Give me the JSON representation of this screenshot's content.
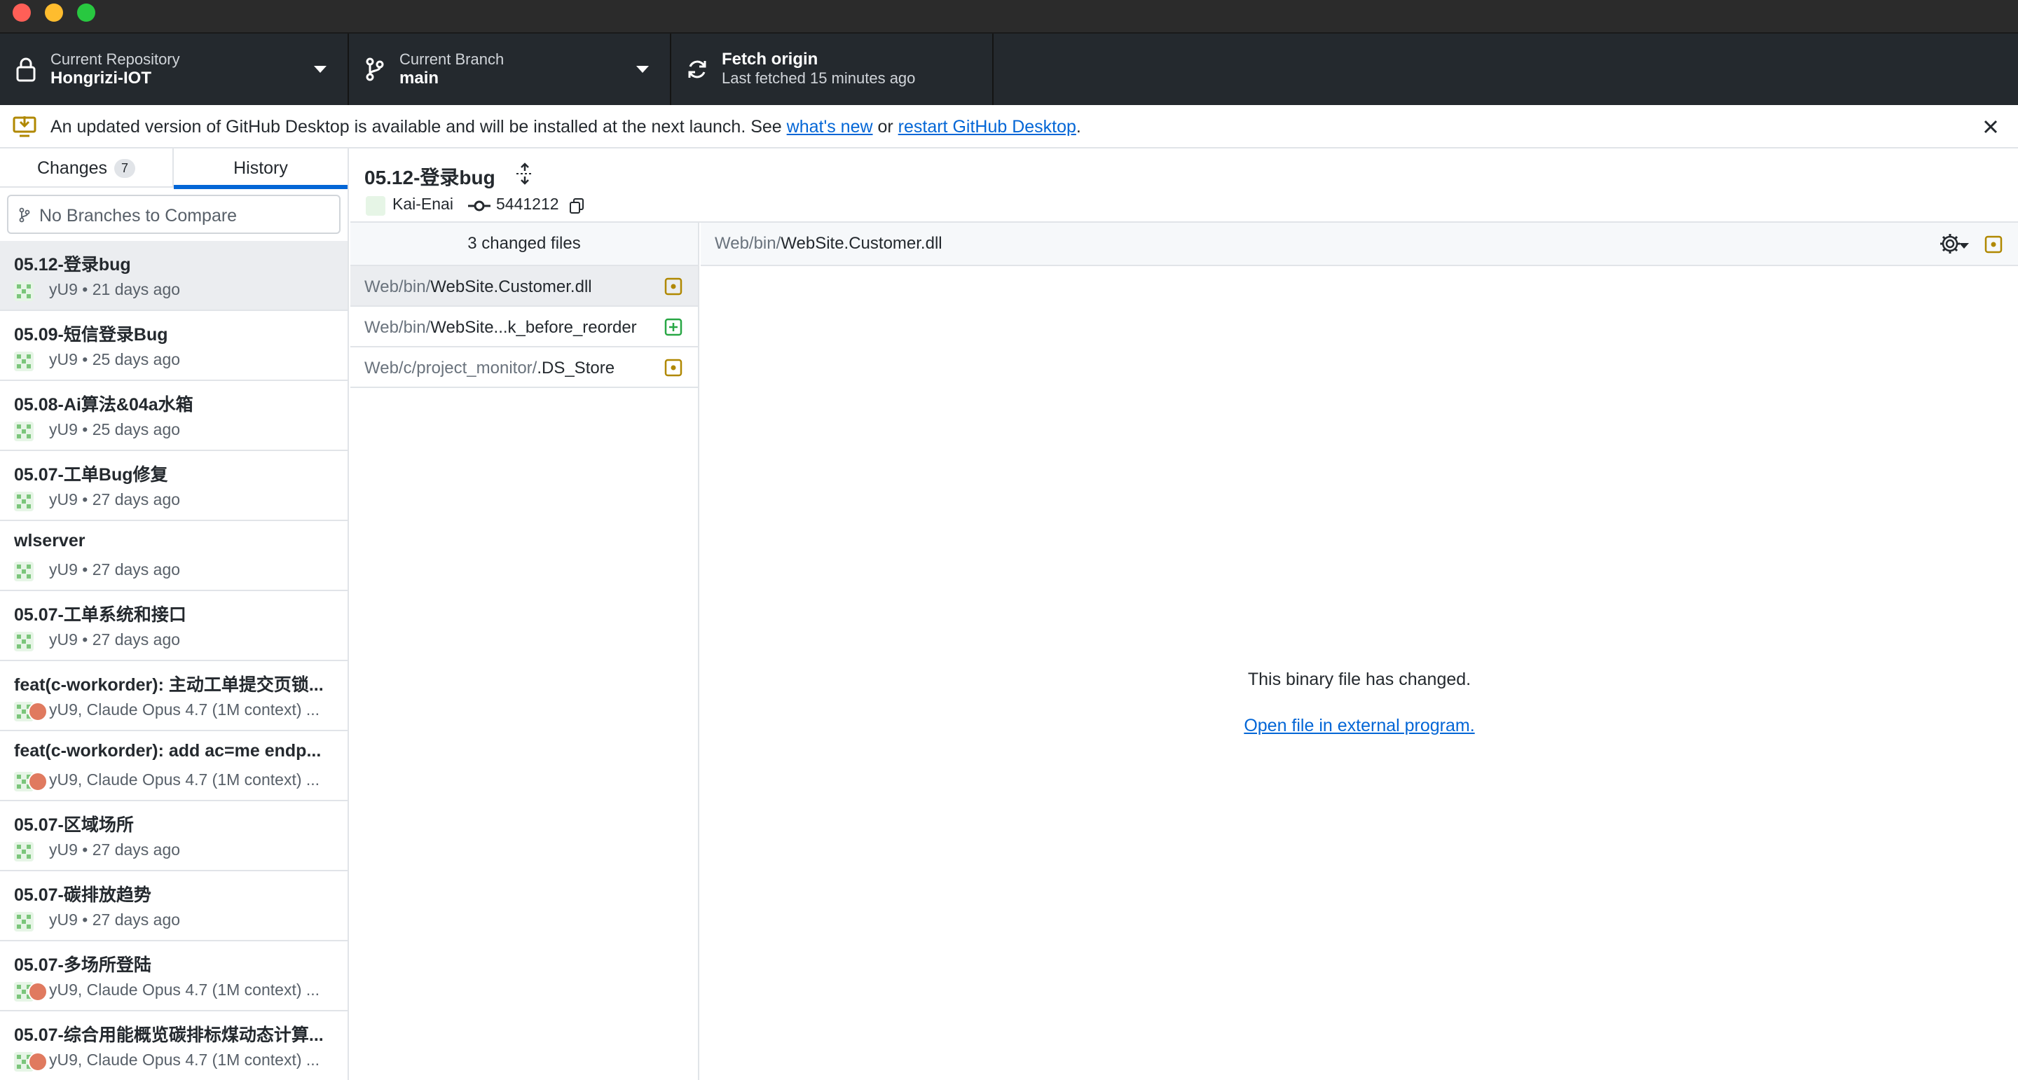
{
  "toolbar": {
    "repository": {
      "sub": "Current Repository",
      "main": "Hongrizi-IOT"
    },
    "branch": {
      "sub": "Current Branch",
      "main": "main"
    },
    "fetch": {
      "main": "Fetch origin",
      "sub": "Last fetched 15 minutes ago"
    }
  },
  "banner": {
    "text_before": "An updated version of GitHub Desktop is available and will be installed at the next launch. See ",
    "link1": "what's new",
    "text_mid": " or ",
    "link2": "restart GitHub Desktop",
    "text_after": "."
  },
  "sidebar": {
    "tabs": {
      "changes": "Changes",
      "changes_count": "7",
      "history": "History"
    },
    "compare_placeholder": "No Branches to Compare",
    "commits": [
      {
        "title": "05.12-登录bug",
        "meta": "yU9 • 21 days ago",
        "multi": false
      },
      {
        "title": "05.09-短信登录Bug",
        "meta": "yU9 • 25 days ago",
        "multi": false
      },
      {
        "title": "05.08-Ai算法&04a水箱",
        "meta": "yU9 • 25 days ago",
        "multi": false
      },
      {
        "title": "05.07-工单Bug修复",
        "meta": "yU9 • 27 days ago",
        "multi": false
      },
      {
        "title": "wlserver",
        "meta": "yU9 • 27 days ago",
        "multi": false
      },
      {
        "title": "05.07-工单系统和接口",
        "meta": "yU9 • 27 days ago",
        "multi": false
      },
      {
        "title": "feat(c-workorder): 主动工单提交页锁...",
        "meta": "yU9, Claude Opus 4.7 (1M context) ...",
        "multi": true
      },
      {
        "title": "feat(c-workorder): add ac=me endp...",
        "meta": "yU9, Claude Opus 4.7 (1M context) ...",
        "multi": true
      },
      {
        "title": "05.07-区域场所",
        "meta": "yU9 • 27 days ago",
        "multi": false
      },
      {
        "title": "05.07-碳排放趋势",
        "meta": "yU9 • 27 days ago",
        "multi": false
      },
      {
        "title": "05.07-多场所登陆",
        "meta": "yU9, Claude Opus 4.7 (1M context) ...",
        "multi": true
      },
      {
        "title": "05.07-综合用能概览碳排标煤动态计算...",
        "meta": "yU9, Claude Opus 4.7 (1M context) ...",
        "multi": true
      }
    ]
  },
  "commit_header": {
    "title": "05.12-登录bug",
    "author": "Kai-Enai",
    "sha": "5441212"
  },
  "files": {
    "header": "3 changed files",
    "items": [
      {
        "dir": "Web/bin/",
        "name": "WebSite.Customer.dll",
        "status": "modified"
      },
      {
        "dir": "Web/bin/",
        "name": "WebSite...k_before_reorder",
        "status": "added"
      },
      {
        "dir": "Web/c/project_monitor/",
        "name": ".DS_Store",
        "status": "modified"
      }
    ]
  },
  "diff": {
    "path_dir": "Web/bin/",
    "path_name": "WebSite.Customer.dll",
    "message": "This binary file has changed.",
    "open_link": "Open file in external program."
  },
  "colors": {
    "toolbar_bg": "#24292e",
    "accent_blue": "#0366d6",
    "modified": "#b08800",
    "added": "#28a745"
  }
}
